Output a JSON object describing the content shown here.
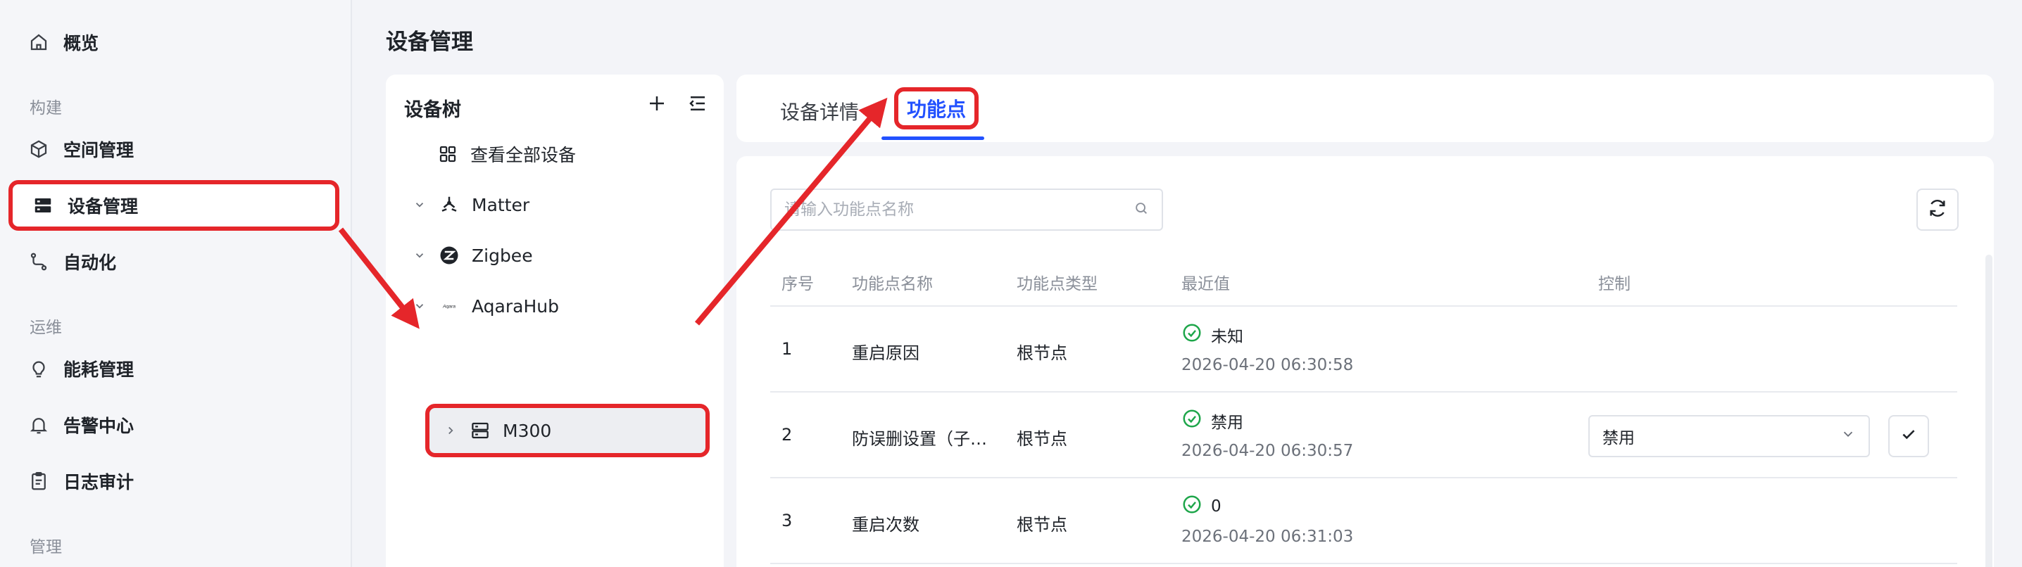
{
  "sidebar": {
    "overview": "概览",
    "group_build": "构建",
    "space": "空间管理",
    "devices": "设备管理",
    "automation": "自动化",
    "group_ops": "运维",
    "energy": "能耗管理",
    "alarms": "告警中心",
    "logs": "日志审计",
    "group_manage": "管理"
  },
  "page": {
    "title": "设备管理"
  },
  "tree": {
    "title": "设备树",
    "view_all": "查看全部设备",
    "nodes": [
      "Matter",
      "Zigbee",
      "AqaraHub"
    ],
    "aqara_logo": "Aqara",
    "selected": "M300"
  },
  "tabs": {
    "details": "设备详情",
    "functions": "功能点"
  },
  "search": {
    "placeholder": "请输入功能点名称"
  },
  "table": {
    "headers": [
      "序号",
      "功能点名称",
      "功能点类型",
      "最近值",
      "控制"
    ],
    "rows": [
      {
        "no": "1",
        "name": "重启原因",
        "type": "根节点",
        "value": "未知",
        "time": "2026-04-20 06:30:58"
      },
      {
        "no": "2",
        "name": "防误删设置（子…",
        "type": "根节点",
        "value": "禁用",
        "time": "2026-04-20 06:30:57",
        "control": "禁用"
      },
      {
        "no": "3",
        "name": "重启次数",
        "type": "根节点",
        "value": "0",
        "time": "2026-04-20 06:31:03"
      }
    ]
  },
  "colors": {
    "accent": "#2251ff",
    "annotation": "#e5262a",
    "ok": "#1ea64a"
  }
}
